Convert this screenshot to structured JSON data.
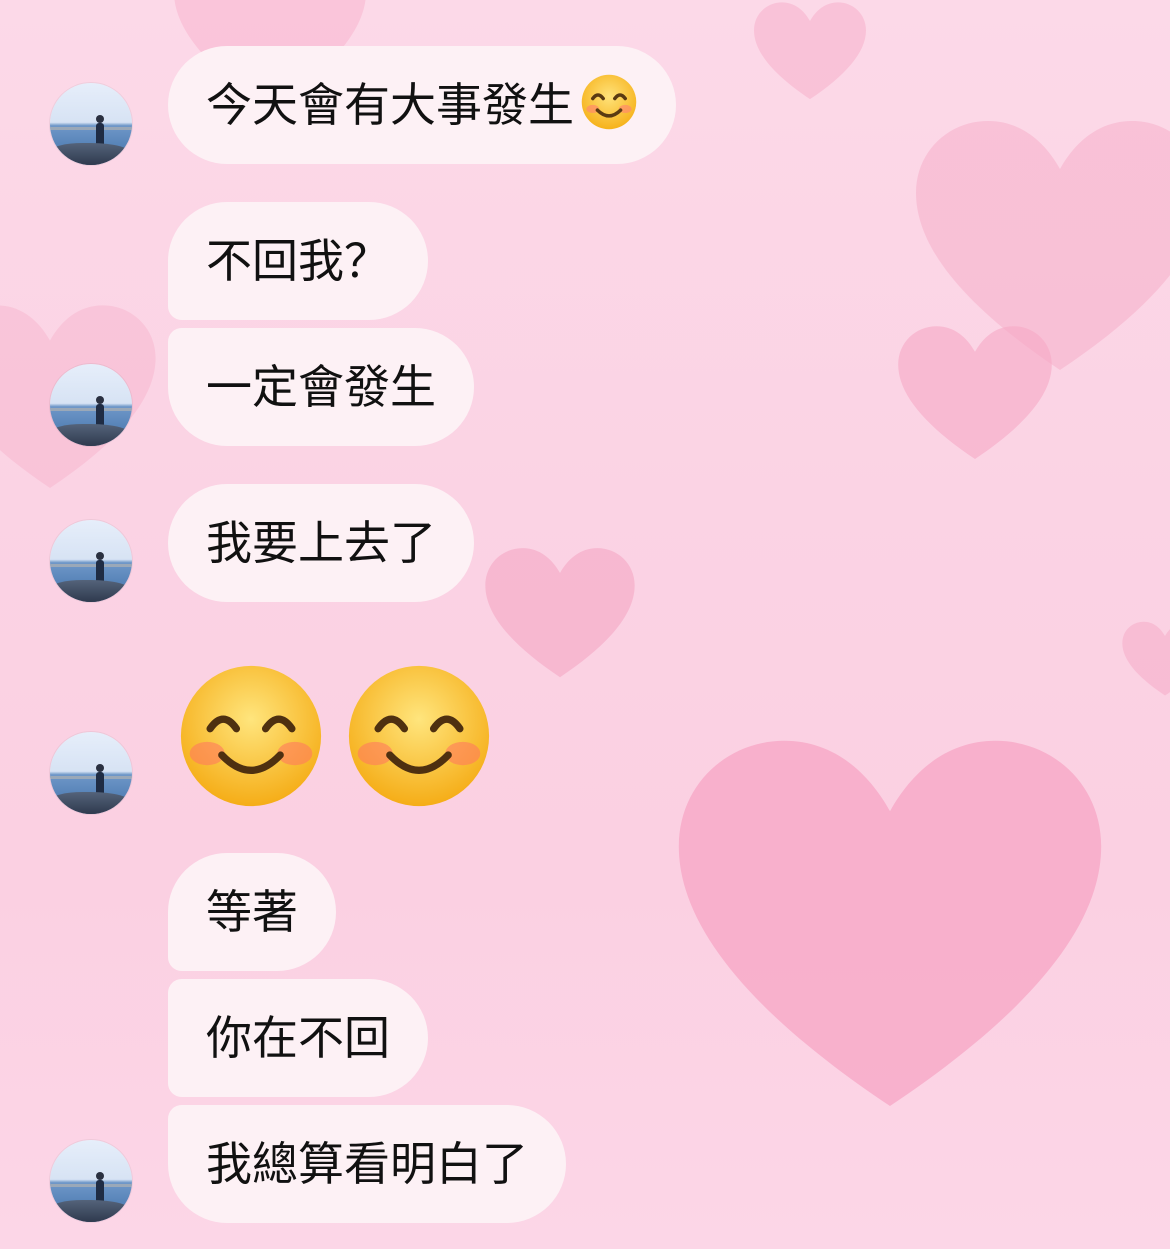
{
  "chat": {
    "messages": [
      {
        "text": "今天會有大事發生",
        "emoji": "smiling-face-with-smiling-eyes"
      },
      {
        "text": "不回我？"
      },
      {
        "text": "一定會發生"
      },
      {
        "text": "我要上去了"
      },
      {
        "emoji_only": [
          "smiling-face-with-smiling-eyes",
          "smiling-face-with-smiling-eyes"
        ]
      },
      {
        "text": "等著"
      },
      {
        "text": "你在不回"
      },
      {
        "text": "我總算看明白了"
      }
    ]
  },
  "theme": {
    "background": "#fbd3e4",
    "bubble_color": "#fdf1f5",
    "text_color": "#111111",
    "heart_color": "#f7a9c6"
  }
}
